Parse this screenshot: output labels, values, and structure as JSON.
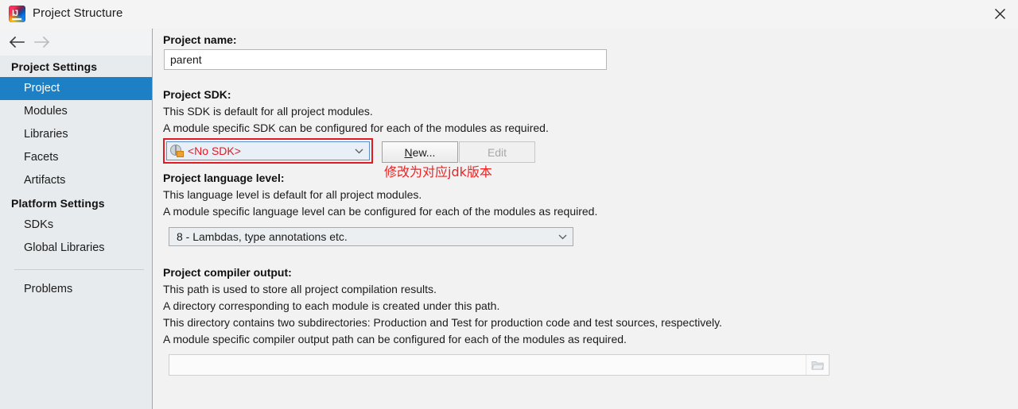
{
  "window": {
    "title": "Project Structure",
    "app_icon": "intellij-idea-icon",
    "close_icon": "close-icon",
    "back_icon": "arrow-left-icon",
    "forward_icon": "arrow-right-icon"
  },
  "sidebar": {
    "groups": [
      {
        "header": "Project Settings",
        "items": [
          {
            "label": "Project",
            "selected": true
          },
          {
            "label": "Modules",
            "selected": false
          },
          {
            "label": "Libraries",
            "selected": false
          },
          {
            "label": "Facets",
            "selected": false
          },
          {
            "label": "Artifacts",
            "selected": false
          }
        ]
      },
      {
        "header": "Platform Settings",
        "items": [
          {
            "label": "SDKs",
            "selected": false
          },
          {
            "label": "Global Libraries",
            "selected": false
          }
        ]
      }
    ],
    "problems": {
      "label": "Problems"
    }
  },
  "main": {
    "project_name": {
      "label": "Project name:",
      "value": "parent",
      "placeholder": ""
    },
    "project_sdk": {
      "label": "Project SDK:",
      "desc1": "This SDK is default for all project modules.",
      "desc2": "A module specific SDK can be configured for each of the modules as required.",
      "selected": "<No SDK>",
      "icon": "sdk-globe-lock-icon",
      "chevron_icon": "chevron-down-icon",
      "new_button": "New...",
      "new_button_mnemonic": "N",
      "new_button_rest": "ew...",
      "edit_button": "Edit",
      "annotation": "修改为对应jdk版本"
    },
    "language_level": {
      "label": "Project language level:",
      "desc1": "This language level is default for all project modules.",
      "desc2": "A module specific language level can be configured for each of the modules as required.",
      "selected": "8 - Lambdas, type annotations etc.",
      "chevron_icon": "chevron-down-icon"
    },
    "compiler_output": {
      "label": "Project compiler output:",
      "desc1": "This path is used to store all project compilation results.",
      "desc2": "A directory corresponding to each module is created under this path.",
      "desc3": "This directory contains two subdirectories: Production and Test for production code and test sources, respectively.",
      "desc4": "A module specific compiler output path can be configured for each of the modules as required.",
      "value": "",
      "placeholder": "",
      "browse_icon": "folder-open-icon"
    }
  },
  "colors": {
    "selection": "#1d7fc4",
    "error_red": "#e01b24",
    "annotation_red": "#ee2222",
    "sidebar_bg": "#e8ebed",
    "content_bg": "#f2f2f2"
  }
}
